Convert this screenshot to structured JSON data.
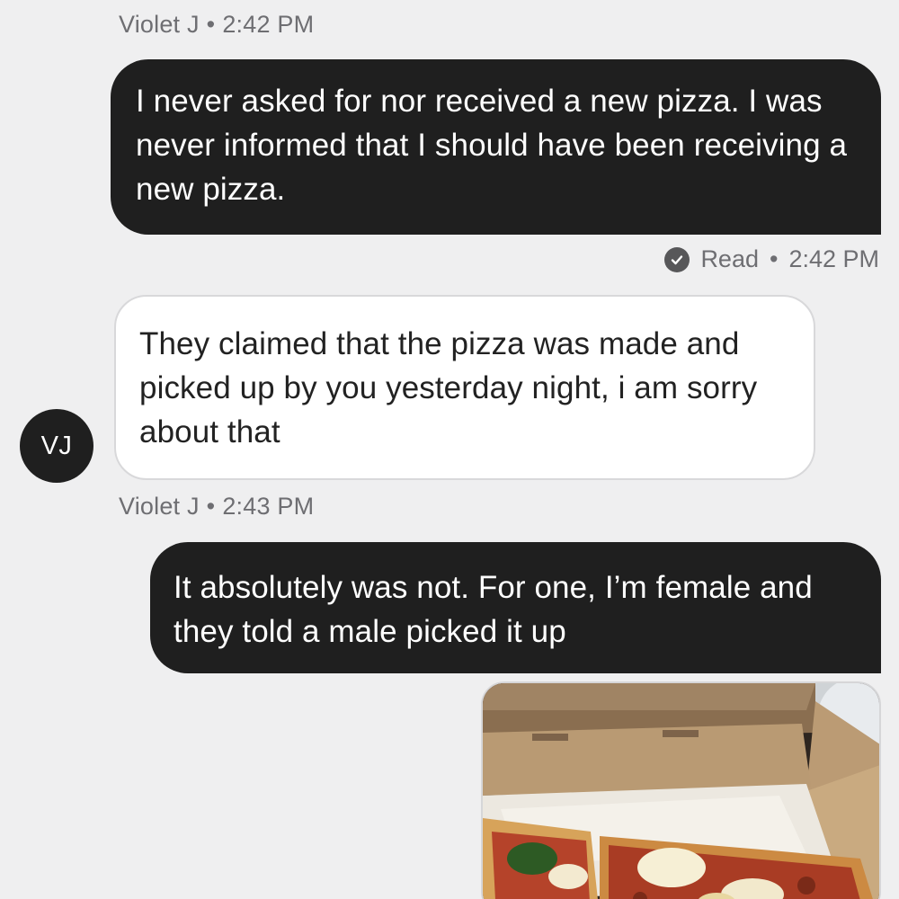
{
  "messages": [
    {
      "sender": "Violet J",
      "time": "2:42 PM",
      "text": "I never asked for nor received a new pizza. I was never informed that I should have been receiving a new pizza."
    },
    {
      "read_label": "Read",
      "read_time": "2:42 PM",
      "text": "They claimed that the pizza was made and picked up by you yesterday night, i am sorry about that",
      "avatar_initials": "VJ"
    },
    {
      "sender": "Violet J",
      "time": "2:43 PM",
      "text": "It absolutely was not. For one, I’m female and they told a male picked it up"
    }
  ],
  "meta_separator": "•",
  "attachment": {
    "icon": "photo-icon"
  },
  "colors": {
    "sent_bubble": "#1f1f1f",
    "received_bubble": "#ffffff",
    "background": "#efeff0",
    "meta_text": "#6e6e72"
  }
}
